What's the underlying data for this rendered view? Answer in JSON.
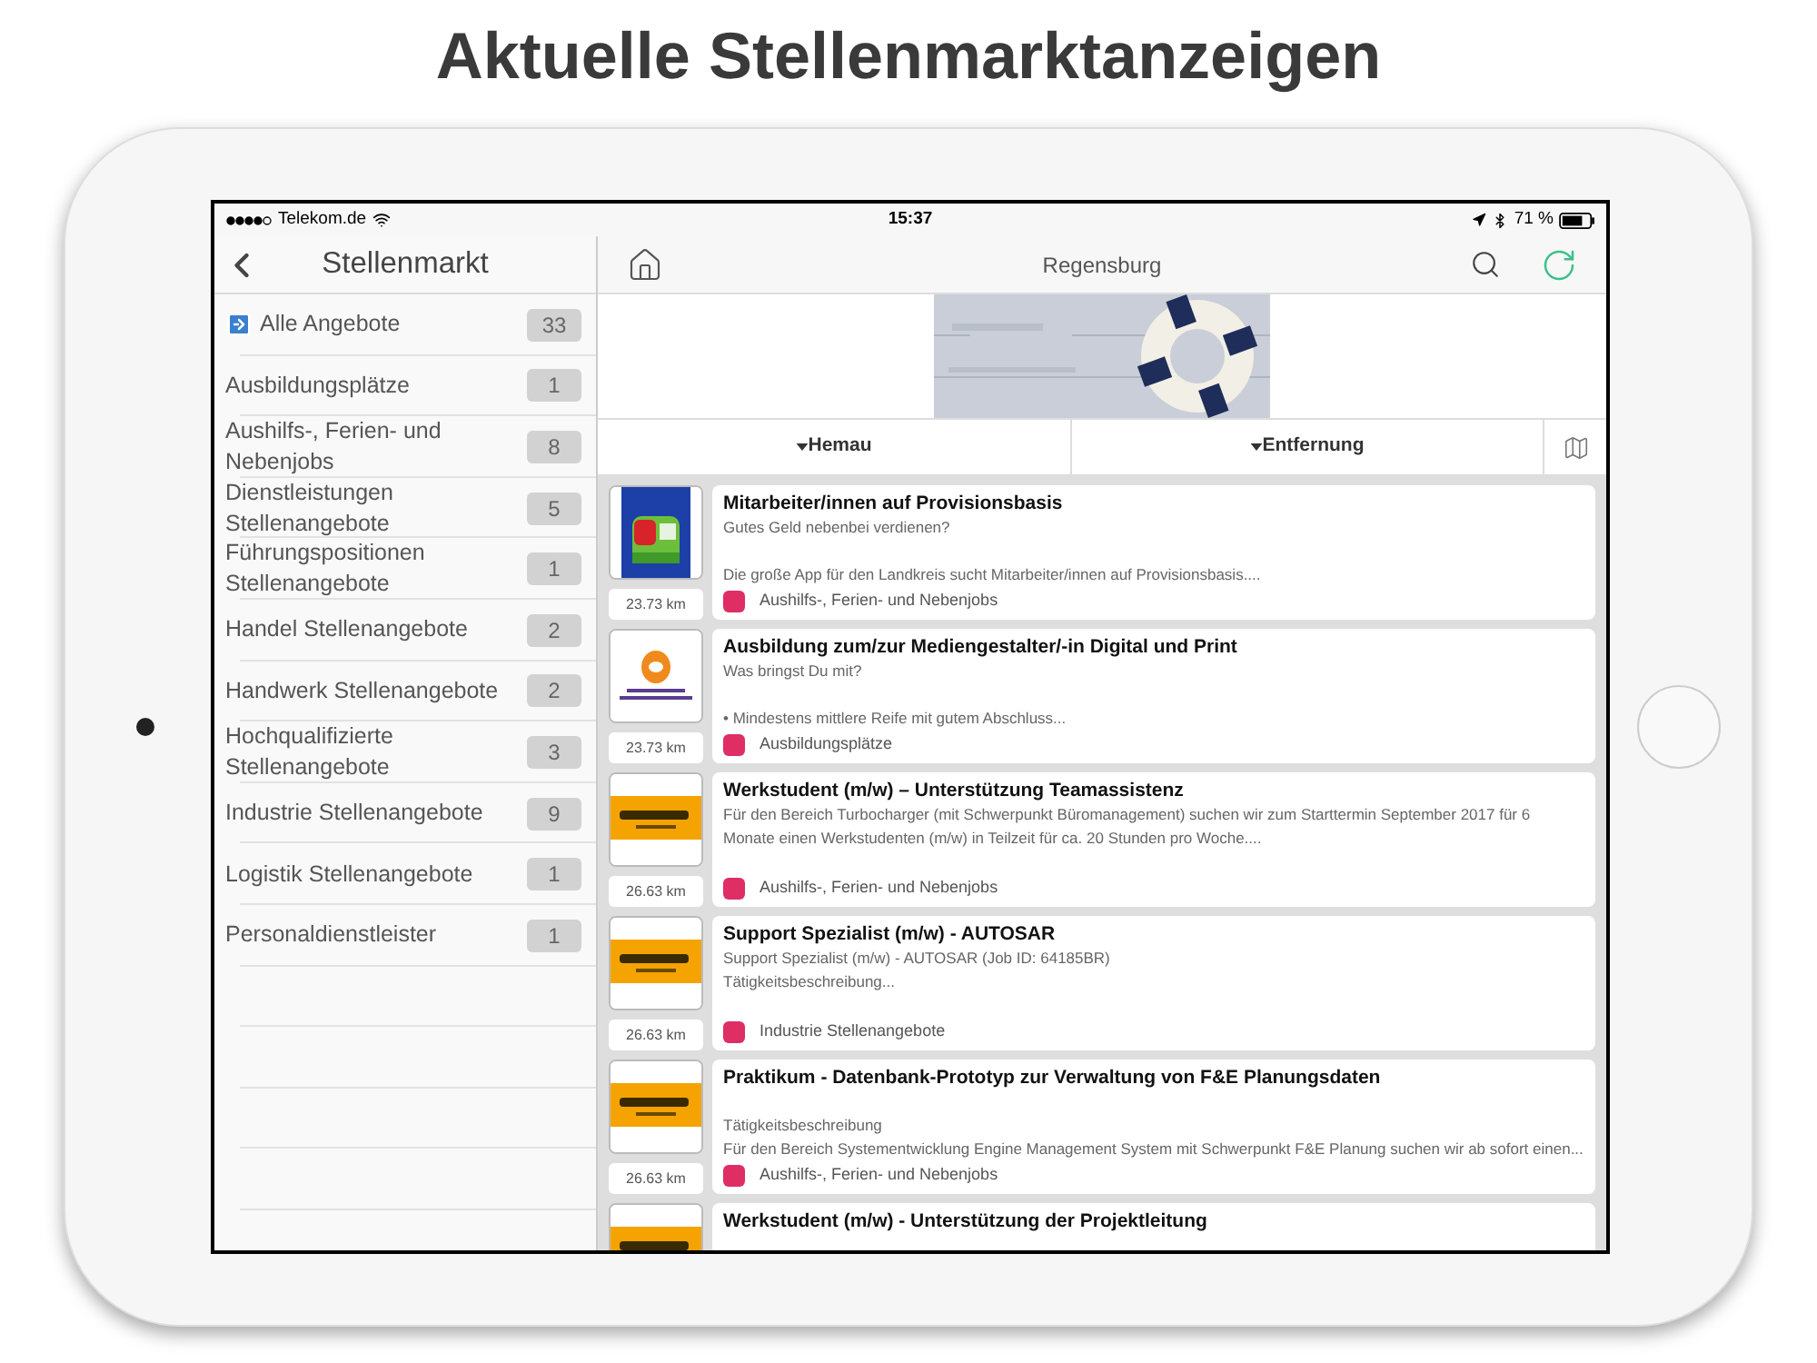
{
  "headline": "Aktuelle Stellenmarktanzeigen",
  "status_bar": {
    "carrier": "Telekom.de",
    "time": "15:37",
    "battery": "71 %"
  },
  "sidebar": {
    "title": "Stellenmarkt",
    "items": [
      {
        "label": "Alle Angebote",
        "count": "33",
        "kind": "all"
      },
      {
        "label": "Ausbildungsplätze",
        "count": "1",
        "kind": "category"
      },
      {
        "label": "Aushilfs-, Ferien- und Nebenjobs",
        "count": "8",
        "kind": "category"
      },
      {
        "label": "Dienstleistungen Stellenangebote",
        "count": "5",
        "kind": "category"
      },
      {
        "label": "Führungspositionen Stellenangebote",
        "count": "1",
        "kind": "category"
      },
      {
        "label": "Handel Stellenangebote",
        "count": "2",
        "kind": "category"
      },
      {
        "label": "Handwerk Stellenangebote",
        "count": "2",
        "kind": "category"
      },
      {
        "label": "Hochqualifizierte Stellenangebote",
        "count": "3",
        "kind": "category"
      },
      {
        "label": "Industrie Stellenangebote",
        "count": "9",
        "kind": "category"
      },
      {
        "label": "Logistik Stellenangebote",
        "count": "1",
        "kind": "category"
      },
      {
        "label": "Personaldienstleister",
        "count": "1",
        "kind": "category"
      }
    ]
  },
  "main": {
    "title": "Regensburg",
    "filters": [
      {
        "label": "Hemau"
      },
      {
        "label": "Entfernung"
      }
    ],
    "listings": [
      {
        "title": "Mitarbeiter/innen auf Provisionsbasis",
        "top_lines": [
          "Gutes Geld nebenbei verdienen?"
        ],
        "bottom_lines": [
          "Die große App für den Landkreis sucht Mitarbeiter/innen auf Provisionsbasis...."
        ],
        "distance": "23.73 km",
        "category": "Aushilfs-, Ferien- und Nebenjobs",
        "color": "#de2e64"
      },
      {
        "title": "Ausbildung zum/zur Mediengestalter/-in Digital und Print",
        "top_lines": [
          "Was bringst Du mit?"
        ],
        "bottom_lines": [
          "• Mindestens mittlere Reife mit gutem Abschluss..."
        ],
        "distance": "23.73 km",
        "category": "Ausbildungsplätze",
        "color": "#de2e64"
      },
      {
        "title": "Werkstudent (m/w) – Unterstützung Teamassistenz",
        "top_lines": [
          "Für den Bereich Turbocharger (mit Schwerpunkt Büromanagement) suchen wir zum Starttermin September 2017 für 6",
          "Monate einen Werkstudenten (m/w) in Teilzeit für ca. 20 Stunden pro Woche...."
        ],
        "distance": "26.63 km",
        "category": "Aushilfs-, Ferien- und Nebenjobs",
        "color": "#de2e64"
      },
      {
        "title": "Support Spezialist (m/w) - AUTOSAR",
        "top_lines": [
          "Support Spezialist (m/w) - AUTOSAR (Job ID: 64185BR)",
          "Tätigkeitsbeschreibung..."
        ],
        "distance": "26.63 km",
        "category": "Industrie Stellenangebote",
        "color": "#de2e64"
      },
      {
        "title": "Praktikum - Datenbank-Prototyp zur Verwaltung von F&E Planungsdaten",
        "bottom_lines": [
          "Tätigkeitsbeschreibung",
          "Für den Bereich Systementwicklung Engine Management System mit Schwerpunkt F&E Planung suchen wir ab sofort einen..."
        ],
        "distance": "26.63 km",
        "category": "Aushilfs-, Ferien- und Nebenjobs",
        "color": "#de2e64"
      },
      {
        "title": "Werkstudent (m/w) - Unterstützung der Projektleitung"
      }
    ]
  }
}
